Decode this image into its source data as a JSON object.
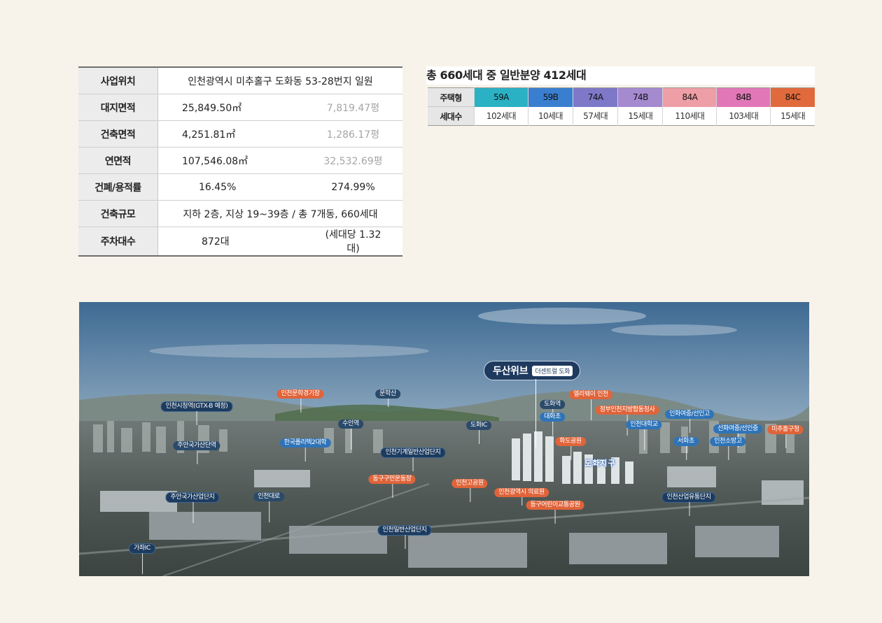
{
  "info_table": {
    "rows": [
      {
        "label": "사업위치",
        "value": "인천광역시 미추홀구 도화동 53-28번지 일원",
        "value2": ""
      },
      {
        "label": "대지면적",
        "value": "25,849.50㎡",
        "value2": "7,819.47평"
      },
      {
        "label": "건축면적",
        "value": "4,251.81㎡",
        "value2": "1,286.17평"
      },
      {
        "label": "연면적",
        "value": "107,546.08㎡",
        "value2": "32,532.69평"
      },
      {
        "label": "건폐/용적률",
        "value": "16.45%",
        "value2": "274.99%"
      },
      {
        "label": "건축규모",
        "value": "지하 2층, 지상 19~39층 / 총 7개동, 660세대",
        "value2": ""
      },
      {
        "label": "주차대수",
        "value": "872대",
        "value2": "(세대당 1.32대)"
      }
    ]
  },
  "unit_table": {
    "title": "총 660세대 중 일반분양 412세대",
    "type_header": "주택형",
    "count_header": "세대수",
    "types": [
      {
        "name": "59A",
        "count": "102세대",
        "color": "#2bb1c4"
      },
      {
        "name": "59B",
        "count": "10세대",
        "color": "#3a7fcf"
      },
      {
        "name": "74A",
        "count": "57세대",
        "color": "#7e78c8"
      },
      {
        "name": "74B",
        "count": "15세대",
        "color": "#a58ad0"
      },
      {
        "name": "84A",
        "count": "110세대",
        "color": "#ee9ea6"
      },
      {
        "name": "84B",
        "count": "103세대",
        "color": "#e277b8"
      },
      {
        "name": "84C",
        "count": "15세대",
        "color": "#e06a3c"
      }
    ]
  },
  "aerial_map": {
    "main_label": "두산위브",
    "main_sub": "더센트럴 도화",
    "site_label": "도화지구",
    "landmarks": {
      "incheon_city_hall": "인천시청역(GTX-B 예정)",
      "incheon_munhak_stadium": "인천문학경기장",
      "munhaksan": "문학산",
      "dohwa_station": "도화역",
      "elevated_incheon": "엘리웨이 인천",
      "daehwa_elementary": "대화초",
      "justice_complex": "정부인천지방합동청사",
      "inhwa_middle_seonin_high": "인화여중/선인고",
      "incheon_univ": "인천대학교",
      "seonhwa_middle": "선화여중/선인중",
      "michuhol_office": "미추홀구청",
      "suan_station": "수인역",
      "dohwa_ic": "도화IC",
      "juan_digital": "주안국가산단역",
      "korea_poly": "한국폴리텍2대학",
      "incheon_machinery": "인천기계일반산업단지",
      "hwado_park": "화도공원",
      "seohwa_elementary": "서화초",
      "fire_high": "인천소방고",
      "donggu_sports": "동구구민운동장",
      "incheon_high_park": "인천고공원",
      "incheon_medical": "인천광역시 의료원",
      "donggu_traffic_park": "동구어린이교통공원",
      "logistics_complex": "인천산업유통단지",
      "juan_industrial": "주안국가산업단지",
      "incheon_road": "인천대로",
      "incheon_general": "인천일반산업단지",
      "gajwa_ic": "가좌IC"
    }
  }
}
